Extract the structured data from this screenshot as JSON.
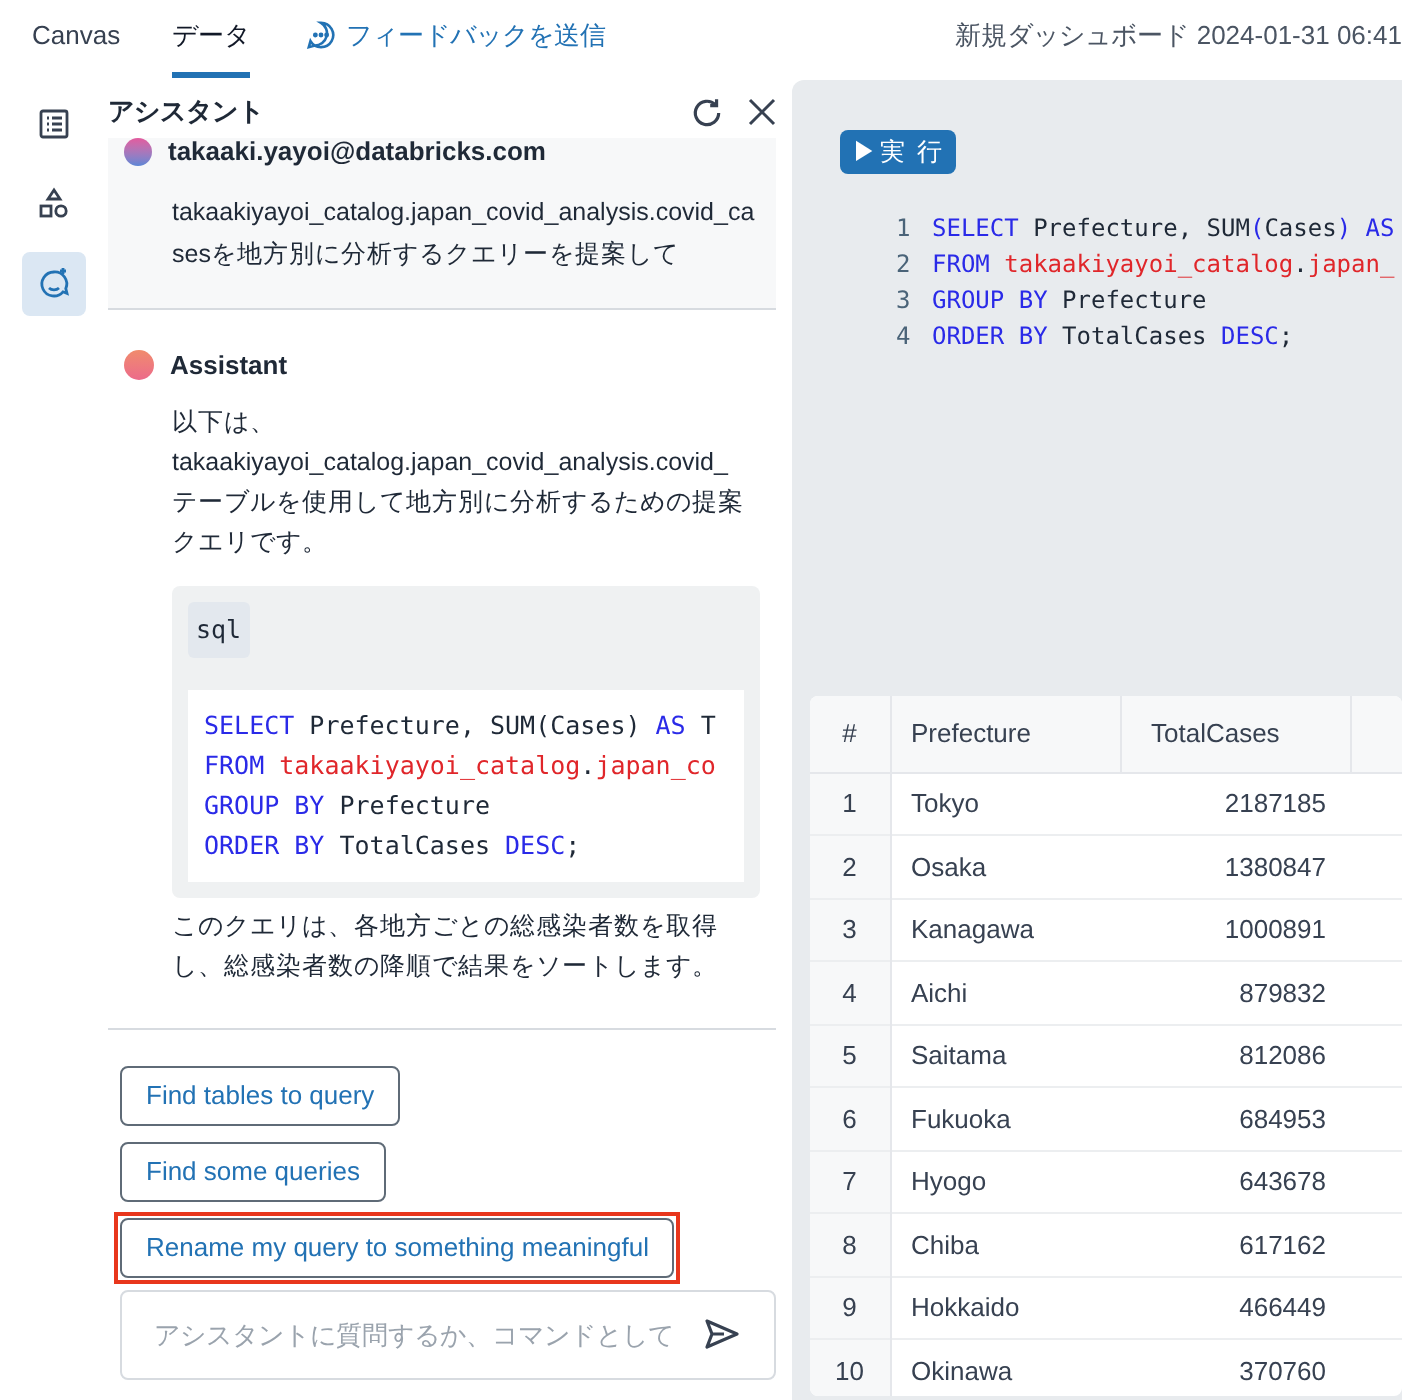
{
  "top_bar": {
    "tabs": [
      {
        "label": "Canvas",
        "selected": false
      },
      {
        "label": "データ",
        "selected": true
      }
    ],
    "feedback_link": "フィードバックを送信",
    "dashboard_title": "新規ダッシュボード 2024-01-31 06:41"
  },
  "rail": [
    {
      "selected": false
    },
    {
      "selected": false
    },
    {
      "selected": true
    }
  ],
  "assistant": {
    "title": "アシスタント",
    "user_message": {
      "author": "takaaki.yayoi@databricks.com",
      "text": "takaakiyayoi_catalog.japan_covid_analysis.covid_casesを地方別に分析するクエリーを提案して"
    },
    "reply": {
      "author": "Assistant",
      "intro": "以下は、takaakiyayoi_catalog.japan_covid_analysis.covid_テーブルを使用して地方別に分析するための提案クエリです。",
      "code_language": "sql",
      "code": [
        [
          {
            "text": "SELECT",
            "kind": "keyword"
          },
          {
            "text": " Prefecture, SUM(Cases) ",
            "kind": "plain"
          },
          {
            "text": "AS",
            "kind": "keyword"
          },
          {
            "text": " T",
            "kind": "plain"
          }
        ],
        [
          {
            "text": "FROM",
            "kind": "keyword"
          },
          {
            "text": " takaakiyayoi_catalog",
            "kind": "name"
          },
          {
            "text": ".",
            "kind": "plain"
          },
          {
            "text": "japan_co",
            "kind": "name"
          }
        ],
        [
          {
            "text": "GROUP BY",
            "kind": "keyword"
          },
          {
            "text": " Prefecture",
            "kind": "plain"
          }
        ],
        [
          {
            "text": "ORDER BY",
            "kind": "keyword"
          },
          {
            "text": " TotalCases ",
            "kind": "plain"
          },
          {
            "text": "DESC",
            "kind": "keyword"
          },
          {
            "text": ";",
            "kind": "plain"
          }
        ]
      ],
      "outro": "このクエリは、各地方ごとの総感染者数を取得し、総感染者数の降順で結果をソートします。"
    },
    "suggestions": [
      {
        "label": "Find tables to query",
        "highlighted": false
      },
      {
        "label": "Find some queries",
        "highlighted": false
      },
      {
        "label": "Rename my query to something meaningful",
        "highlighted": true
      }
    ],
    "input": {
      "placeholder": "アシスタントに質問するか、コマンドとして"
    }
  },
  "editor": {
    "run_button": "▶実 行",
    "lines": [
      {
        "number": "1",
        "tokens": [
          {
            "text": "SELECT",
            "kind": "keyword"
          },
          {
            "text": " Prefecture, SUM",
            "kind": "plain"
          },
          {
            "text": "(",
            "kind": "keyword"
          },
          {
            "text": "Cases",
            "kind": "plain"
          },
          {
            "text": ") AS",
            "kind": "keyword"
          }
        ]
      },
      {
        "number": "2",
        "tokens": [
          {
            "text": "FROM",
            "kind": "keyword"
          },
          {
            "text": " takaakiyayoi_catalog",
            "kind": "name"
          },
          {
            "text": ".",
            "kind": "plain"
          },
          {
            "text": "japan_",
            "kind": "name"
          }
        ]
      },
      {
        "number": "3",
        "tokens": [
          {
            "text": "GROUP BY",
            "kind": "keyword"
          },
          {
            "text": " Prefecture",
            "kind": "plain"
          }
        ]
      },
      {
        "number": "4",
        "tokens": [
          {
            "text": "ORDER BY",
            "kind": "keyword"
          },
          {
            "text": " TotalCases ",
            "kind": "plain"
          },
          {
            "text": "DESC",
            "kind": "keyword"
          },
          {
            "text": ";",
            "kind": "plain"
          }
        ]
      }
    ]
  },
  "results": {
    "columns": [
      "#",
      "Prefecture",
      "TotalCases"
    ],
    "rows": [
      [
        "1",
        "Tokyo",
        "2187185"
      ],
      [
        "2",
        "Osaka",
        "1380847"
      ],
      [
        "3",
        "Kanagawa",
        "1000891"
      ],
      [
        "4",
        "Aichi",
        "879832"
      ],
      [
        "5",
        "Saitama",
        "812086"
      ],
      [
        "6",
        "Fukuoka",
        "684953"
      ],
      [
        "7",
        "Hyogo",
        "643678"
      ],
      [
        "8",
        "Chiba",
        "617162"
      ],
      [
        "9",
        "Hokkaido",
        "466449"
      ],
      [
        "10",
        "Okinawa",
        "370760"
      ]
    ]
  }
}
